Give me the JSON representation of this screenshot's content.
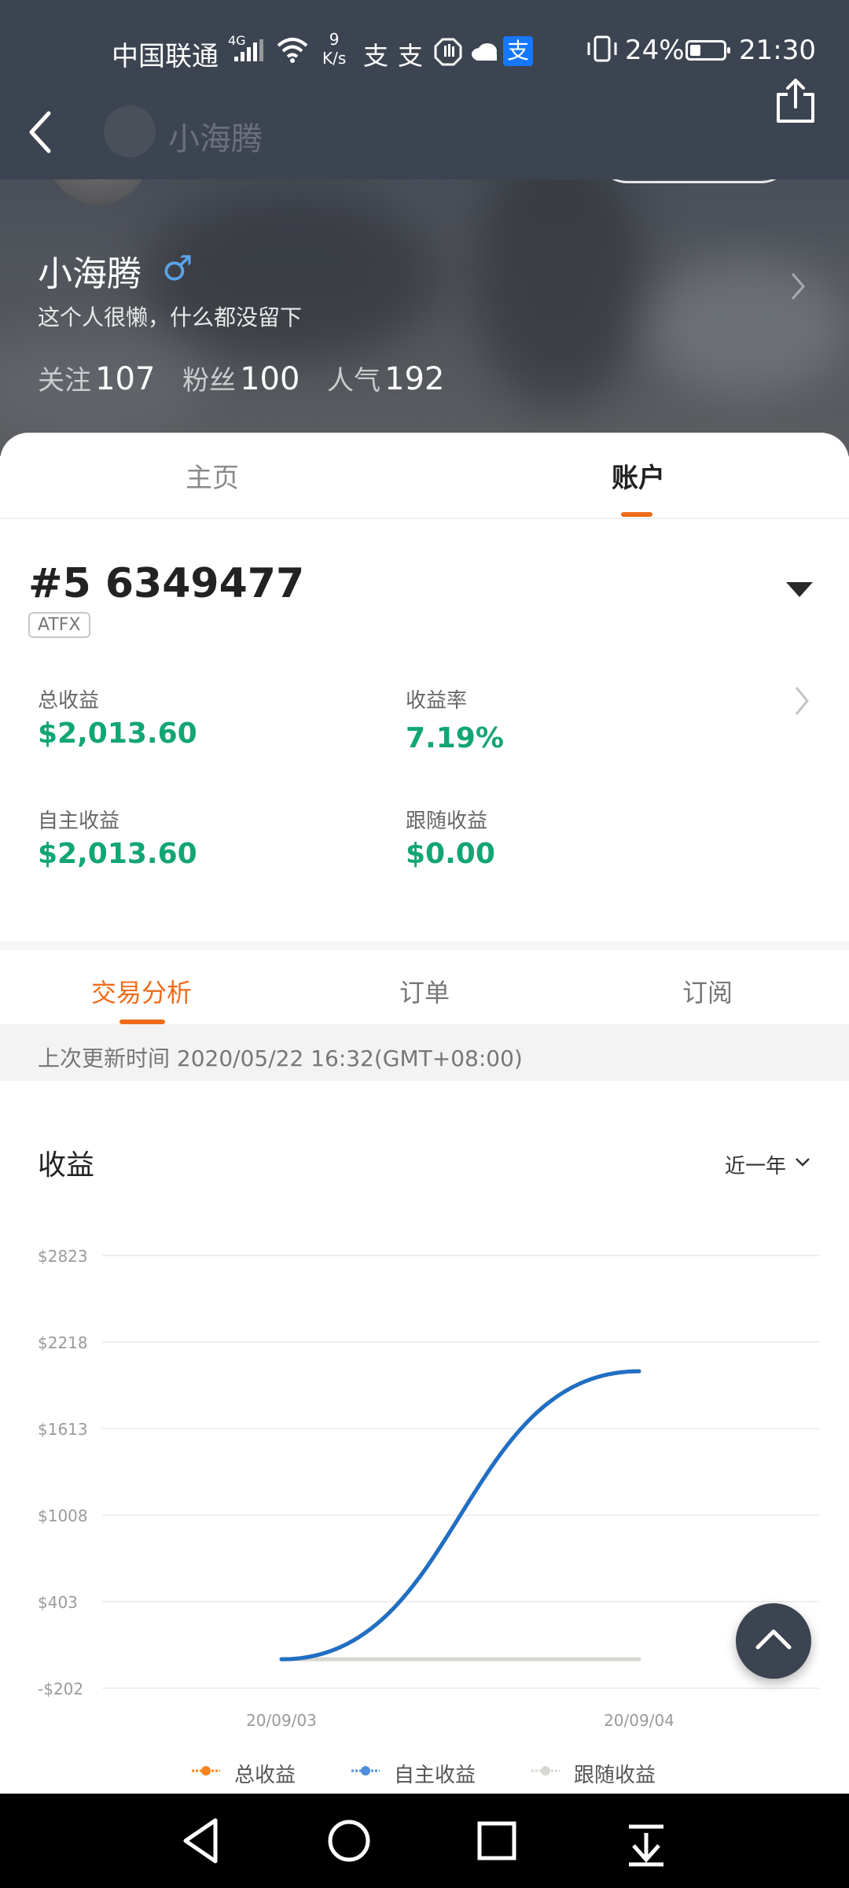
{
  "status_bar": {
    "carrier": "中国联通",
    "network": "4G",
    "speed_value": "9",
    "speed_unit": "K/s",
    "battery_pct": "24%",
    "time": "21:30"
  },
  "top_bar": {
    "back_icon": "chevron-left-icon",
    "share_icon": "share-icon",
    "title": "小海腾"
  },
  "profile": {
    "name": "小海腾",
    "gender_symbol": "♂",
    "signature": "这个人很懒，什么都没留下",
    "stats": [
      {
        "label": "关注",
        "value": "107"
      },
      {
        "label": "粉丝",
        "value": "100"
      },
      {
        "label": "人气",
        "value": "192"
      }
    ]
  },
  "tabs": {
    "home": "主页",
    "account": "账户"
  },
  "account": {
    "number": "#5 6349477",
    "broker": "ATFX",
    "metrics": {
      "total_label": "总收益",
      "total_value": "$2,013.60",
      "rate_label": "收益率",
      "rate_value": "7.19%",
      "own_label": "自主收益",
      "own_value": "$2,013.60",
      "follow_label": "跟随收益",
      "follow_value": "$0.00"
    }
  },
  "sub_tabs": {
    "analysis": "交易分析",
    "orders": "订单",
    "subscriptions": "订阅"
  },
  "update": {
    "text": "上次更新时间 2020/05/22 16:32(GMT+08:00)"
  },
  "chart_section": {
    "title": "收益",
    "range": "近一年"
  },
  "colors": {
    "accent": "#ef6c1a",
    "profit_green": "#12a672",
    "series_total": "#f5841f",
    "series_own": "#1e6fc6",
    "series_follow": "#d8d6d0"
  },
  "chart_data": {
    "type": "line",
    "x": [
      "20/09/03",
      "20/09/04"
    ],
    "y_ticks": [
      "$2823",
      "$2218",
      "$1613",
      "$1008",
      "$403",
      "-$202"
    ],
    "ylim": [
      -202,
      2823
    ],
    "grid": true,
    "legend_position": "bottom",
    "series": [
      {
        "name": "总收益",
        "values": [
          0,
          2013.6
        ],
        "color": "#f5841f"
      },
      {
        "name": "自主收益",
        "values": [
          0,
          2013.6
        ],
        "color": "#1e6fc6"
      },
      {
        "name": "跟随收益",
        "values": [
          0,
          0
        ],
        "color": "#d8d6d0"
      }
    ]
  },
  "nav": {
    "back_icon": "triangle-back-icon",
    "home_icon": "circle-home-icon",
    "recents_icon": "square-recents-icon",
    "menu_icon": "down-arrow-menu-icon"
  }
}
